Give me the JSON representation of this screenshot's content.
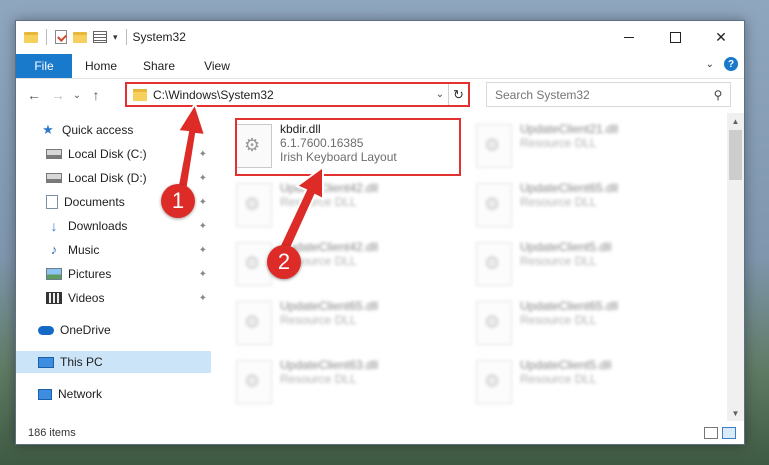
{
  "window": {
    "title": "System32",
    "controls": {
      "close": "✕"
    }
  },
  "ribbon": {
    "tabs": [
      "File",
      "Home",
      "Share",
      "View"
    ],
    "help": "?"
  },
  "address": {
    "path": "C:\\Windows\\System32",
    "refresh": "↻",
    "search_placeholder": "Search System32"
  },
  "nav": {
    "back": "←",
    "forward": "→",
    "recent": "⌄",
    "up": "↑"
  },
  "sidebar": {
    "items": [
      {
        "label": "Quick access",
        "icon": "star-icon"
      },
      {
        "label": "Local Disk (C:)",
        "icon": "disk-icon",
        "pinned": true
      },
      {
        "label": "Local Disk (D:)",
        "icon": "disk-icon",
        "pinned": true
      },
      {
        "label": "Documents",
        "icon": "documents-icon",
        "pinned": true
      },
      {
        "label": "Downloads",
        "icon": "download-icon",
        "pinned": true
      },
      {
        "label": "Music",
        "icon": "music-icon",
        "pinned": true
      },
      {
        "label": "Pictures",
        "icon": "pictures-icon",
        "pinned": true
      },
      {
        "label": "Videos",
        "icon": "videos-icon",
        "pinned": true
      },
      {
        "label": "OneDrive",
        "icon": "onedrive-icon"
      },
      {
        "label": "This PC",
        "icon": "pc-icon",
        "selected": true
      },
      {
        "label": "Network",
        "icon": "network-icon"
      }
    ],
    "pin_glyph": "📌"
  },
  "files": [
    {
      "name": "kbdir.dll",
      "line2": "6.1.7600.16385",
      "line3": "Irish Keyboard Layout"
    },
    {
      "name": "UpdateClient21.dll",
      "line2": "Resource DLL"
    },
    {
      "name": "UpdateClient42.dll",
      "line2": "Resource DLL"
    },
    {
      "name": "UpdateClient65.dll",
      "line2": "Resource DLL"
    },
    {
      "name": "UpdateClient42.dll",
      "line2": "Resource DLL"
    },
    {
      "name": "UpdateClient5.dll",
      "line2": "Resource DLL"
    },
    {
      "name": "UpdateClient65.dll",
      "line2": "Resource DLL"
    },
    {
      "name": "UpdateClient65.dll",
      "line2": "Resource DLL"
    },
    {
      "name": "UpdateClient63.dll",
      "line2": "Resource DLL"
    },
    {
      "name": "UpdateClient5.dll",
      "line2": "Resource DLL"
    }
  ],
  "status": {
    "item_count": "186 items"
  },
  "annotations": {
    "step1": "1",
    "step2": "2",
    "color": "#dd2b27"
  }
}
